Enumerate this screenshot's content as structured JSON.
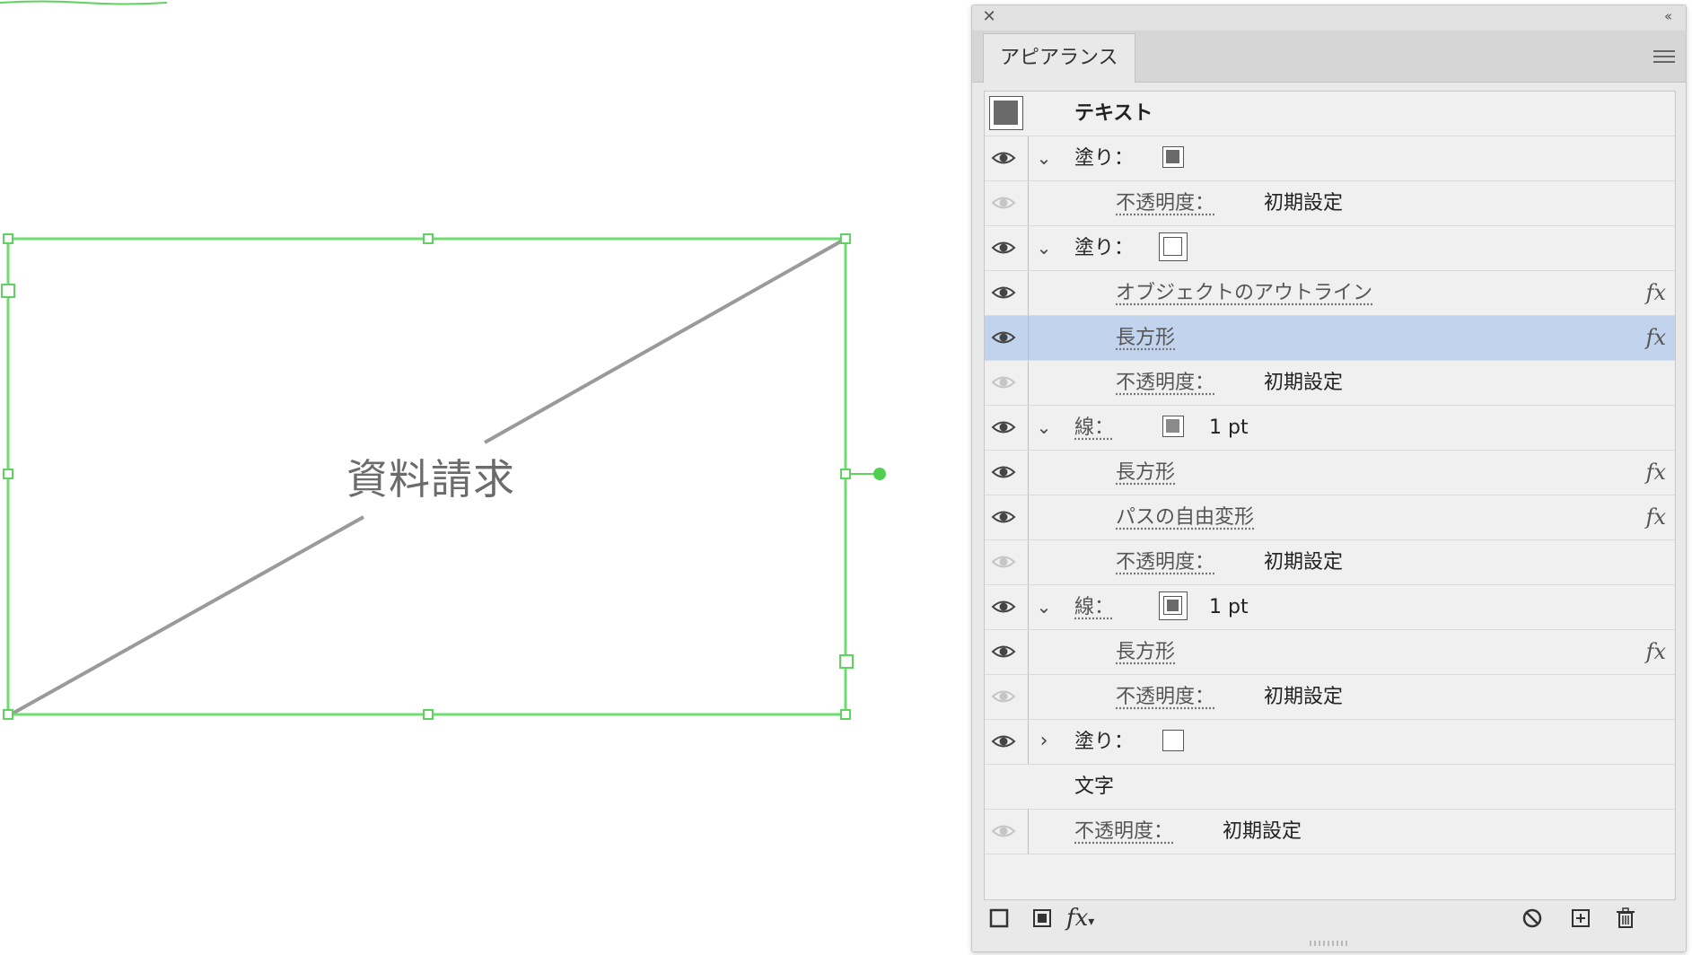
{
  "canvas": {
    "text": "資料請求",
    "colors": {
      "selection": "#5fd35f",
      "line": "#9a9a9a",
      "text": "#6b6b6b"
    }
  },
  "panel": {
    "tab_label": "アピアランス",
    "close_icon": "close-icon",
    "collapse_icon": "collapse-icon",
    "menu_icon": "panel-menu-icon",
    "header": {
      "label": "テキスト"
    },
    "rows": [
      {
        "type": "fill",
        "label": "塗り：",
        "swatch": "dark-gray"
      },
      {
        "type": "opacity",
        "label": "不透明度：",
        "value": "初期設定"
      },
      {
        "type": "fill",
        "label": "塗り：",
        "swatch": "none"
      },
      {
        "type": "effect",
        "label": "オブジェクトのアウトライン",
        "fx": "fx"
      },
      {
        "type": "effect",
        "label": "長方形",
        "fx": "fx",
        "selected": true
      },
      {
        "type": "opacity",
        "label": "不透明度：",
        "value": "初期設定"
      },
      {
        "type": "stroke",
        "label": "線：",
        "swatch": "gray",
        "value": "1 pt"
      },
      {
        "type": "effect",
        "label": "長方形",
        "fx": "fx"
      },
      {
        "type": "effect",
        "label": "パスの自由変形",
        "fx": "fx"
      },
      {
        "type": "opacity",
        "label": "不透明度：",
        "value": "初期設定"
      },
      {
        "type": "stroke",
        "label": "線：",
        "swatch": "gray-ring",
        "value": "1 pt"
      },
      {
        "type": "effect",
        "label": "長方形",
        "fx": "fx"
      },
      {
        "type": "opacity",
        "label": "不透明度：",
        "value": "初期設定"
      },
      {
        "type": "fill",
        "label": "塗り：",
        "swatch": "white",
        "collapsed": true
      },
      {
        "type": "characters",
        "label": "文字"
      },
      {
        "type": "opacity",
        "label": "不透明度：",
        "value": "初期設定"
      }
    ],
    "bottom": {
      "fx_label": "fx",
      "icons": [
        "add-stroke-icon",
        "add-fill-icon",
        "fx-menu-icon",
        "clear-appearance-icon",
        "duplicate-item-icon",
        "delete-item-icon"
      ]
    }
  }
}
